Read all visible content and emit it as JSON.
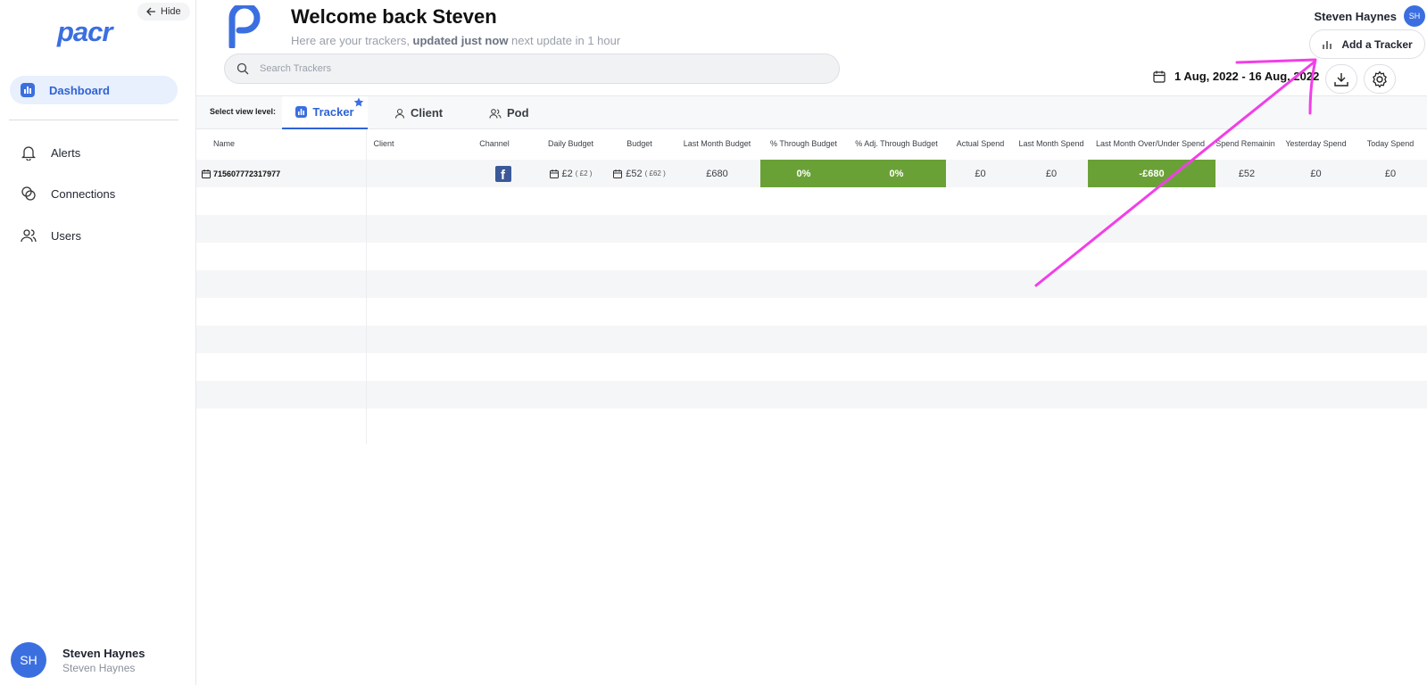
{
  "sidebar": {
    "hide_label": "Hide",
    "logo": "pacr",
    "items": [
      {
        "label": "Dashboard",
        "icon": "bar-chart-icon",
        "active": true
      },
      {
        "label": "Alerts",
        "icon": "bell-icon"
      },
      {
        "label": "Connections",
        "icon": "connections-icon"
      },
      {
        "label": "Users",
        "icon": "users-icon"
      }
    ],
    "user": {
      "initials": "SH",
      "name": "Steven Haynes",
      "sub": "Steven Haynes"
    }
  },
  "header": {
    "title": "Welcome back Steven",
    "subtitle_pre": "Here are your trackers, ",
    "subtitle_bold": "updated just now",
    "subtitle_post": " next update in 1 hour",
    "search_placeholder": "Search Trackers",
    "user_name": "Steven Haynes",
    "user_initials": "SH",
    "add_tracker_label": "Add a Tracker",
    "date_range": "1 Aug, 2022 - 16 Aug, 2022"
  },
  "view_bar": {
    "label": "Select view level:",
    "tabs": [
      {
        "label": "Tracker",
        "active": true
      },
      {
        "label": "Client"
      },
      {
        "label": "Pod"
      }
    ]
  },
  "table": {
    "columns": [
      "Name",
      "Client",
      "Channel",
      "Daily Budget",
      "Budget",
      "Last Month Budget",
      "% Through Budget",
      "% Adj. Through Budget",
      "Actual Spend",
      "Last Month Spend",
      "Last Month Over/Under Spend",
      "Spend Remainin",
      "Yesterday Spend",
      "Today Spend"
    ],
    "rows": [
      {
        "name": "715607772317977",
        "client": "",
        "channel": "facebook",
        "daily_budget": "£2",
        "daily_budget_sub": "( £2 )",
        "budget": "£52",
        "budget_sub": "( £62 )",
        "last_month_budget": "£680",
        "through_budget": "0%",
        "adj_through_budget": "0%",
        "actual_spend": "£0",
        "last_month_spend": "£0",
        "last_month_over_under": "-£680",
        "spend_remaining": "£52",
        "yesterday_spend": "£0",
        "today_spend": "£0"
      }
    ]
  },
  "colors": {
    "accent": "#3b6fe0",
    "green_cell": "#6aa137",
    "annotation": "#f23ee8"
  }
}
